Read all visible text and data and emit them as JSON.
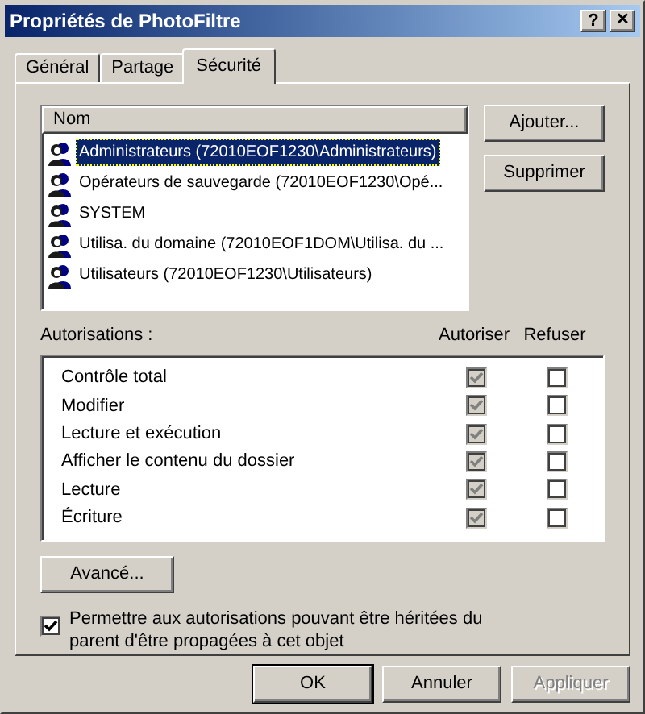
{
  "window": {
    "title": "Propriétés de PhotoFiltre",
    "help": "?",
    "close": "✕"
  },
  "tabs": [
    {
      "label": "Général",
      "selected": false
    },
    {
      "label": "Partage",
      "selected": false
    },
    {
      "label": "Sécurité",
      "selected": true
    }
  ],
  "names": {
    "column": "Nom",
    "items": [
      {
        "label": "Administrateurs (72010EOF1230\\Administrateurs)",
        "selected": true
      },
      {
        "label": "Opérateurs de sauvegarde (72010EOF1230\\Opé...",
        "selected": false
      },
      {
        "label": "SYSTEM",
        "selected": false
      },
      {
        "label": "Utilisa. du domaine (72010EOF1DOM\\Utilisa. du ...",
        "selected": false
      },
      {
        "label": "Utilisateurs (72010EOF1230\\Utilisateurs)",
        "selected": false
      }
    ]
  },
  "side_buttons": [
    {
      "label": "Ajouter..."
    },
    {
      "label": "Supprimer"
    }
  ],
  "permissions": {
    "label": "Autorisations :",
    "columns": [
      "Autoriser",
      "Refuser"
    ],
    "rows": [
      {
        "name": "Contrôle total",
        "allow": {
          "checked": true,
          "disabled": true
        },
        "deny": {
          "checked": false,
          "disabled": false
        }
      },
      {
        "name": "Modifier",
        "allow": {
          "checked": true,
          "disabled": true
        },
        "deny": {
          "checked": false,
          "disabled": false
        }
      },
      {
        "name": "Lecture et exécution",
        "allow": {
          "checked": true,
          "disabled": true
        },
        "deny": {
          "checked": false,
          "disabled": false
        }
      },
      {
        "name": "Afficher le contenu du dossier",
        "allow": {
          "checked": true,
          "disabled": true
        },
        "deny": {
          "checked": false,
          "disabled": false
        }
      },
      {
        "name": "Lecture",
        "allow": {
          "checked": true,
          "disabled": true
        },
        "deny": {
          "checked": false,
          "disabled": false
        }
      },
      {
        "name": "Écriture",
        "allow": {
          "checked": true,
          "disabled": true
        },
        "deny": {
          "checked": false,
          "disabled": false
        }
      }
    ]
  },
  "advanced_button": "Avancé...",
  "inherit": {
    "label": "Permettre aux autorisations pouvant être héritées du parent d'être propagées à cet objet",
    "checked": true
  },
  "buttons": [
    {
      "label": "OK",
      "disabled": false,
      "default": true
    },
    {
      "label": "Annuler",
      "disabled": false,
      "default": false
    },
    {
      "label": "Appliquer",
      "disabled": true,
      "default": false
    }
  ]
}
